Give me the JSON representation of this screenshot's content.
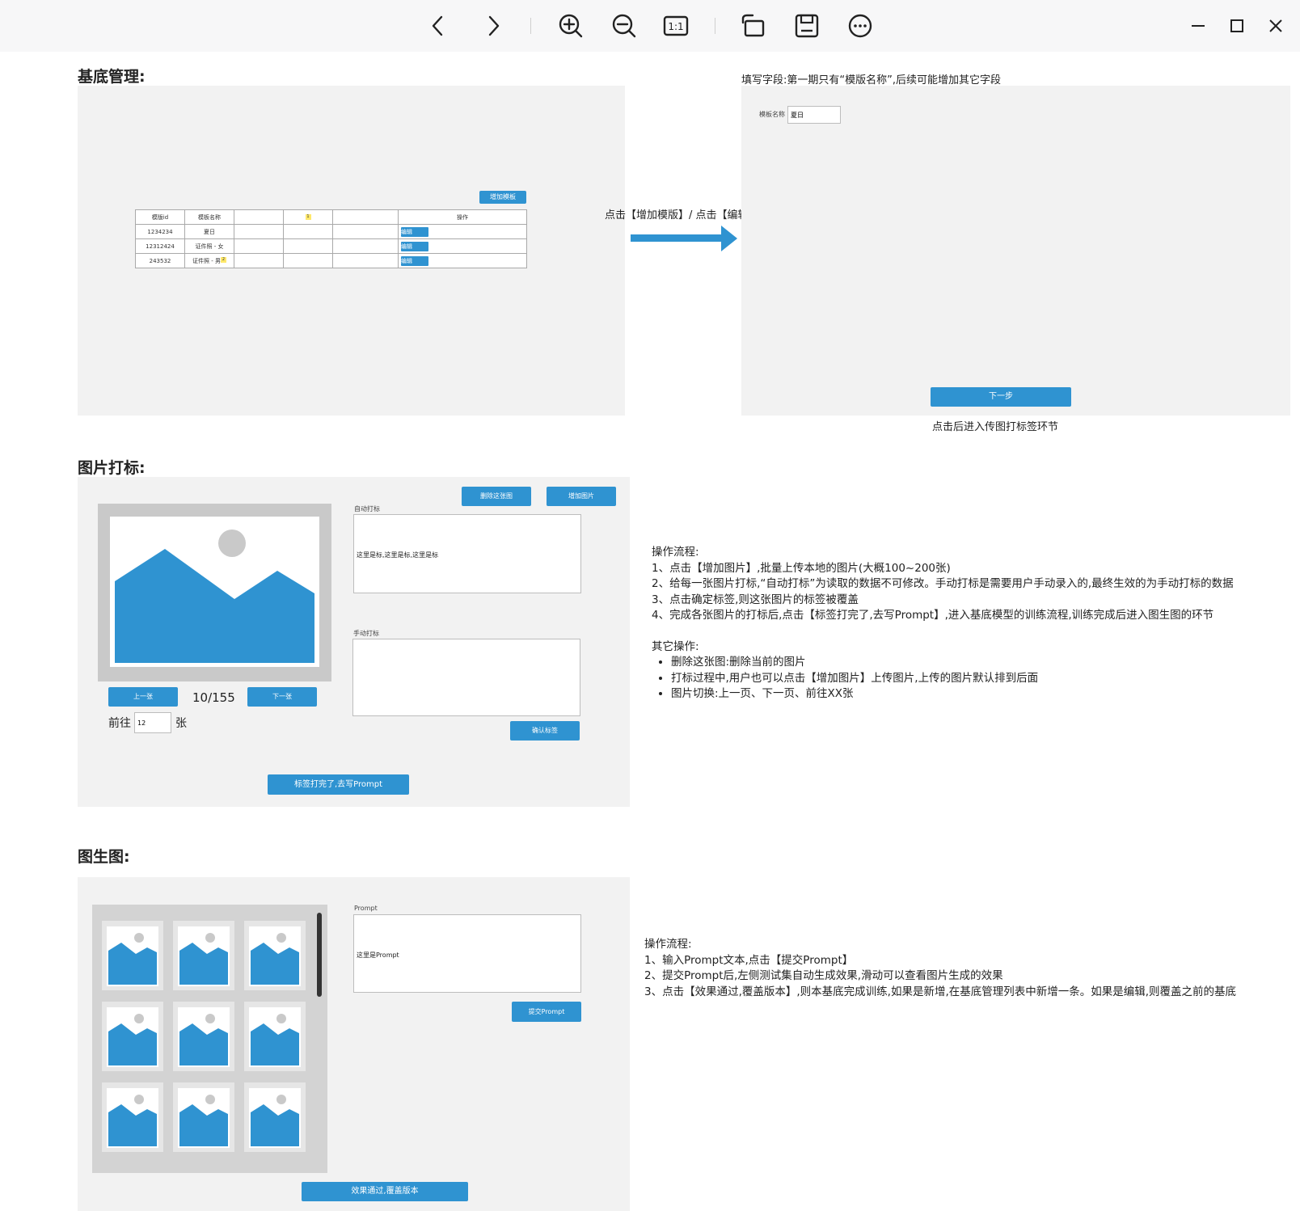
{
  "toolbar": {
    "icons": [
      "back-icon",
      "forward-icon",
      "zoom-in-icon",
      "zoom-out-icon",
      "actual-size-icon",
      "rotate-icon",
      "save-icon",
      "more-icon"
    ],
    "actual_size_label": "1:1",
    "window_icons": [
      "minimize-icon",
      "maximize-icon",
      "close-icon"
    ]
  },
  "section1": {
    "title": "基底管理:",
    "add_template_button": "增加模板",
    "table": {
      "headers": [
        "模版id",
        "模板名称",
        "",
        "",
        "",
        "操作"
      ],
      "header_flag": "1",
      "rows": [
        {
          "id": "1234234",
          "name": "夏日",
          "edit": "编辑"
        },
        {
          "id": "12312424",
          "name": "证件照 - 女",
          "edit": "编辑"
        },
        {
          "id": "243532",
          "name": "证件照 - 男",
          "edit": "编辑",
          "flag": "2"
        }
      ]
    },
    "arrow_label": "点击【增加模版】/ 点击【编辑】",
    "field_note": "填写字段:第一期只有“模版名称”,后续可能增加其它字段",
    "form": {
      "label": "模板名称",
      "value": "夏日",
      "next_button": "下一步"
    },
    "after_note": "点击后进入传图打标签环节"
  },
  "section2": {
    "title": "图片打标:",
    "delete_button": "删除这张图",
    "add_image_button": "增加图片",
    "auto_label_title": "自动打标",
    "auto_label_text": "这里是标,这里是标,这里是标",
    "manual_label_title": "手动打标",
    "manual_label_text": "",
    "prev_button": "上一张",
    "counter": "10/155",
    "next_button": "下一张",
    "goto_prefix": "前往",
    "goto_value": "12",
    "goto_suffix": "张",
    "confirm_button": "确认标签",
    "finish_button": "标签打完了,去写Prompt",
    "process": {
      "title": "操作流程:",
      "steps": [
        "1、点击【增加图片】,批量上传本地的图片(大概100~200张)",
        "2、给每一张图片打标,“自动打标”为读取的数据不可修改。手动打标是需要用户手动录入的,最终生效的为手动打标的数据",
        "3、点击确定标签,则这张图片的标签被覆盖",
        "4、完成各张图片的打标后,点击【标签打完了,去写Prompt】,进入基底模型的训练流程,训练完成后进入图生图的环节"
      ],
      "other_title": "其它操作:",
      "others": [
        "删除这张图:删除当前的图片",
        "打标过程中,用户也可以点击【增加图片】上传图片,上传的图片默认排到后面",
        "图片切换:上一页、下一页、前往XX张"
      ]
    }
  },
  "section3": {
    "title": "图生图:",
    "prompt_title": "Prompt",
    "prompt_text": "这里是Prompt",
    "submit_button": "提交Prompt",
    "pass_button": "效果通过,覆盖版本",
    "process": {
      "title": "操作流程:",
      "steps": [
        "1、输入Prompt文本,点击【提交Prompt】",
        "2、提交Prompt后,左侧测试集自动生成效果,滑动可以查看图片生成的效果",
        "3、点击【效果通过,覆盖版本】,则本基底完成训练,如果是新增,在基底管理列表中新增一条。如果是编辑,则覆盖之前的基底"
      ]
    }
  },
  "colors": {
    "accent": "#2f93d1",
    "panel": "#f2f2f2",
    "toolbar": "#f7f7f8"
  }
}
